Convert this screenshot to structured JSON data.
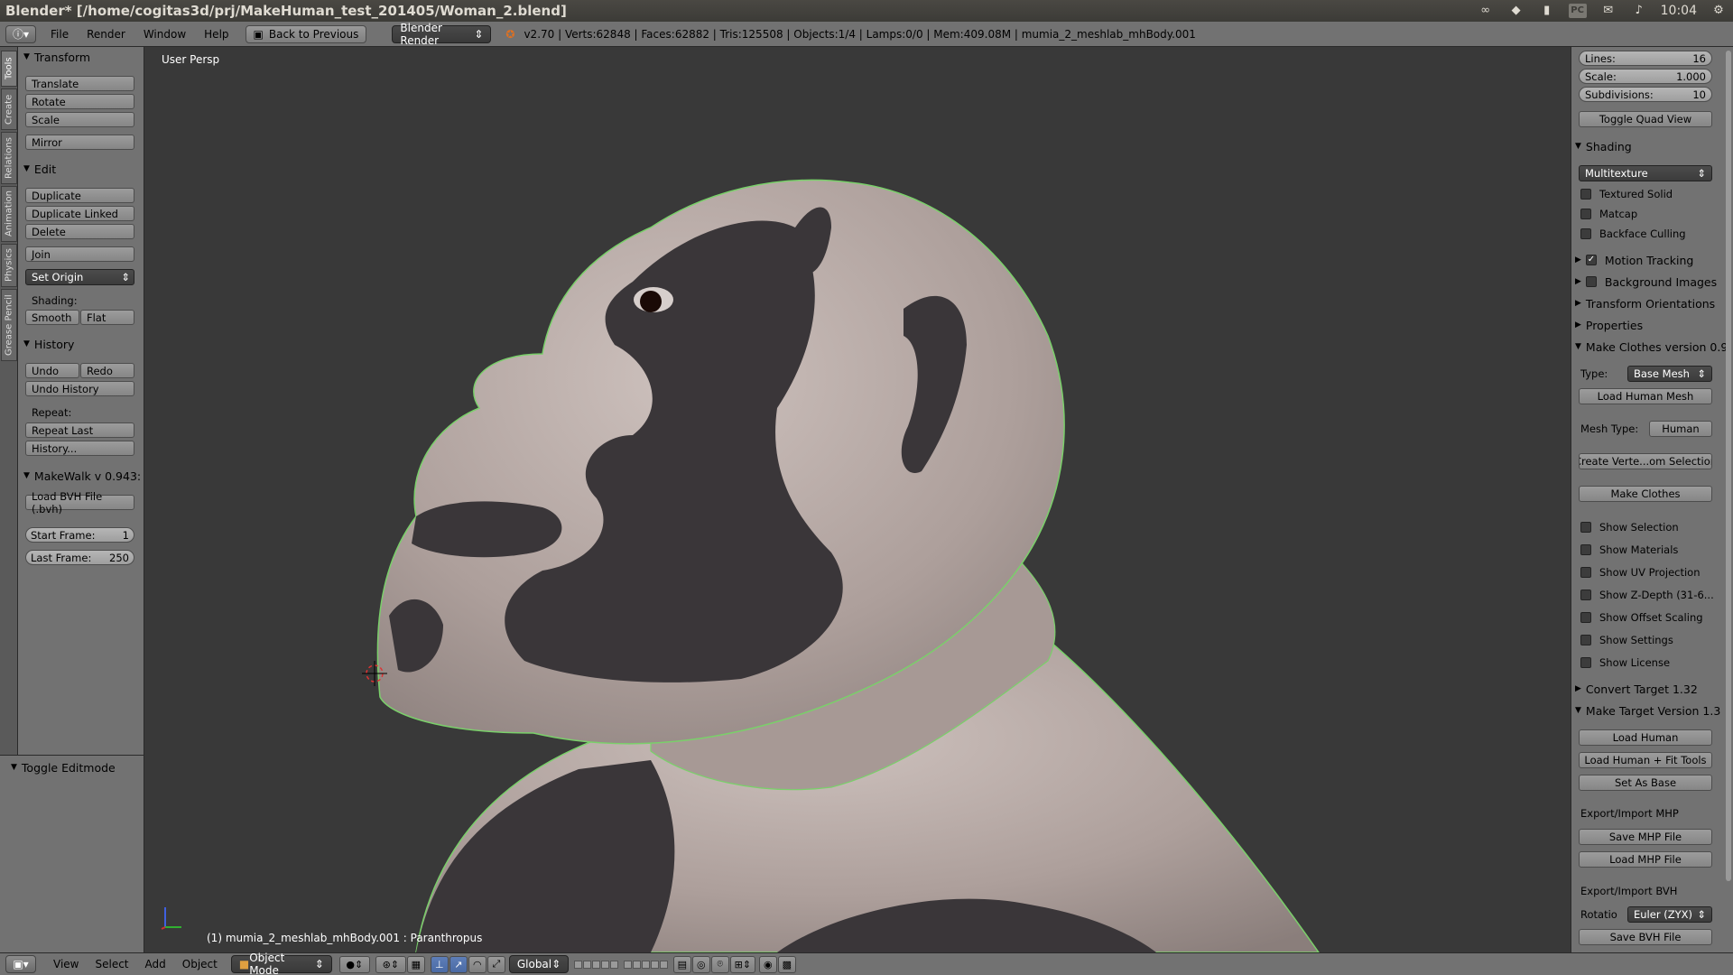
{
  "window_title": "Blender* [/home/cogitas3d/prj/MakeHuman_test_201405/Woman_2.blend]",
  "system": {
    "clock": "10:04"
  },
  "header": {
    "menus": [
      "File",
      "Render",
      "Window",
      "Help"
    ],
    "back_button": "Back to Previous",
    "render_engine": "Blender Render",
    "stats": "v2.70 | Verts:62848 | Faces:62882 | Tris:125508 | Objects:1/4 | Lamps:0/0 | Mem:409.08M | mumia_2_meshlab_mhBody.001"
  },
  "tabs": [
    "Tools",
    "Create",
    "Relations",
    "Animation",
    "Physics",
    "Grease Pencil"
  ],
  "tool_panel": {
    "transform": {
      "title": "Transform",
      "buttons": [
        "Translate",
        "Rotate",
        "Scale",
        "Mirror"
      ]
    },
    "edit": {
      "title": "Edit",
      "buttons": [
        "Duplicate",
        "Duplicate Linked",
        "Delete",
        "Join"
      ],
      "set_origin": "Set Origin",
      "shading_label": "Shading:",
      "smooth": "Smooth",
      "flat": "Flat"
    },
    "history": {
      "title": "History",
      "undo": "Undo",
      "redo": "Redo",
      "undo_history": "Undo History",
      "repeat_label": "Repeat:",
      "repeat_last": "Repeat Last",
      "history_btn": "History..."
    },
    "makewalk": {
      "title": "MakeWalk v 0.943:",
      "load_bvh": "Load BVH File (.bvh)",
      "start_frame_label": "Start Frame:",
      "start_frame": "1",
      "last_frame_label": "Last Frame:",
      "last_frame": "250"
    },
    "toggle_editmode": "Toggle Editmode"
  },
  "viewport": {
    "persp_label": "User Persp",
    "object_label": "(1) mumia_2_meshlab_mhBody.001 : Paranthropus",
    "colors": {
      "skin": "#b4a8a4",
      "dark": "#3a3639",
      "outline": "#7ad06a"
    }
  },
  "properties": {
    "lines_label": "Lines:",
    "lines": "16",
    "scale_label": "Scale:",
    "scale": "1.000",
    "subdiv_label": "Subdivisions:",
    "subdiv": "10",
    "toggle_quad": "Toggle Quad View",
    "shading": {
      "title": "Shading",
      "mode": "Multitexture",
      "textured_solid": "Textured Solid",
      "matcap": "Matcap",
      "backface": "Backface Culling"
    },
    "motion_tracking": "Motion Tracking",
    "background_images": "Background Images",
    "transform_orientations": "Transform Orientations",
    "properties_section": "Properties",
    "make_clothes": {
      "title": "Make Clothes version 0.9",
      "type_label": "Type:",
      "type_value": "Base Mesh",
      "load_human_mesh": "Load Human Mesh",
      "mesh_type_label": "Mesh Type:",
      "mesh_type_value": "Human",
      "create_vertex": "Create Verte...om Selection",
      "make_clothes_btn": "Make Clothes",
      "checks": [
        "Show Selection",
        "Show Materials",
        "Show UV Projection",
        "Show Z-Depth (31-6...",
        "Show Offset Scaling",
        "Show Settings",
        "Show License"
      ]
    },
    "convert_target": "Convert Target 1.32",
    "make_target": {
      "title": "Make Target  Version 1.3",
      "load_human": "Load Human",
      "load_fit": "Load Human + Fit Tools",
      "set_base": "Set As Base",
      "mhp_label": "Export/Import MHP",
      "save_mhp": "Save MHP File",
      "load_mhp": "Load MHP File",
      "bvh_label": "Export/Import BVH",
      "rot_label": "Rotatio",
      "rot_value": "Euler (ZYX)",
      "save_bvh": "Save BVH File"
    }
  },
  "bottom": {
    "menus": [
      "View",
      "Select",
      "Add",
      "Object"
    ],
    "mode": "Object Mode",
    "orientation": "Global"
  }
}
